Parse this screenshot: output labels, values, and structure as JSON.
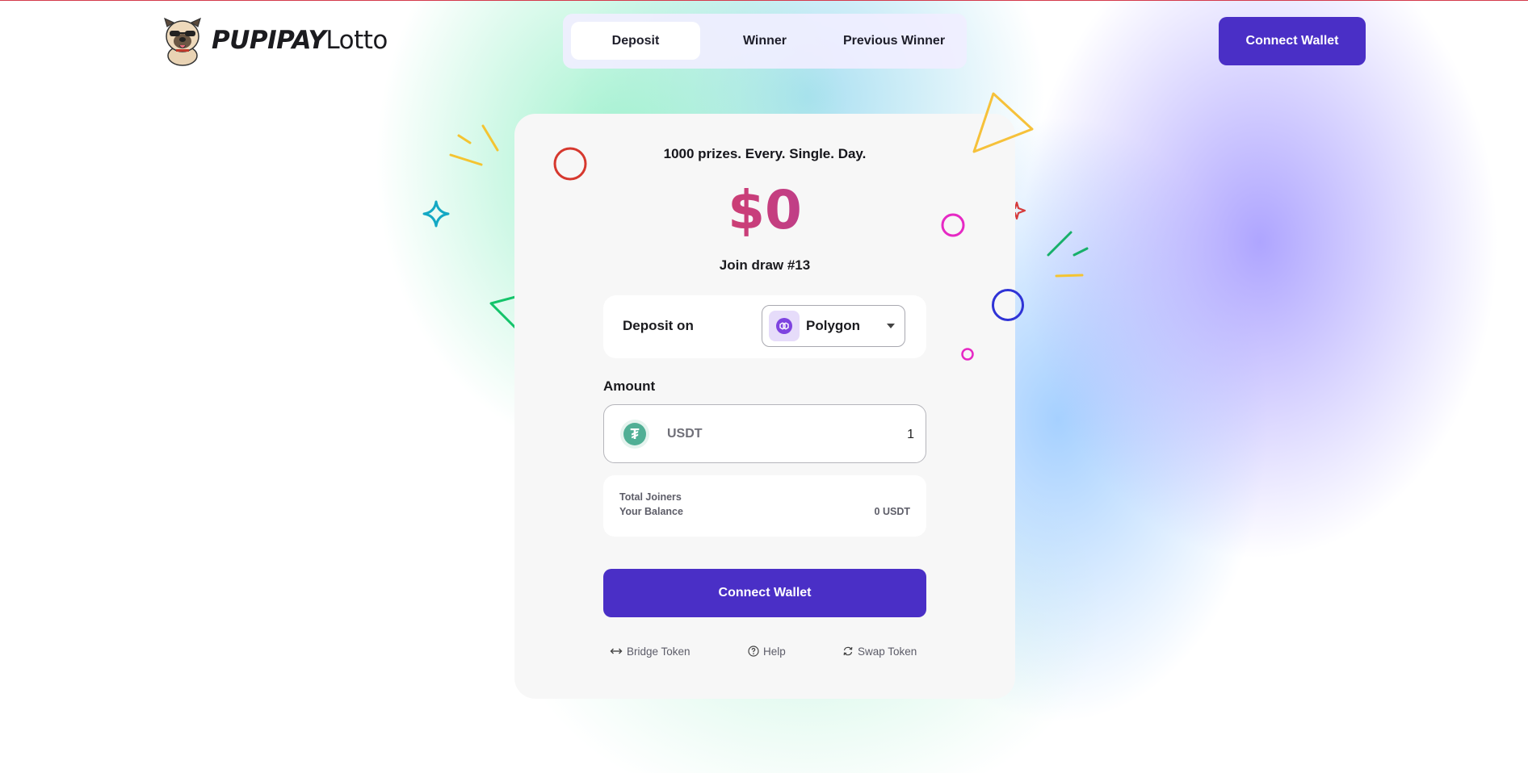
{
  "brand": {
    "bold": "PUPIPAY",
    "light": "Lotto"
  },
  "nav": {
    "tabs": [
      {
        "label": "Deposit",
        "active": true
      },
      {
        "label": "Winner",
        "active": false
      },
      {
        "label": "Previous Winner",
        "active": false
      }
    ],
    "connect_label": "Connect Wallet"
  },
  "card": {
    "tagline": "1000 prizes. Every. Single. Day.",
    "jackpot": "$0",
    "draw": "Join draw #13",
    "deposit_label": "Deposit on",
    "network": {
      "name": "Polygon",
      "icon": "polygon-icon"
    },
    "amount_label": "Amount",
    "amount": {
      "currency": "USDT",
      "value": "1",
      "icon": "tether-icon"
    },
    "stats": {
      "total_joiners_label": "Total Joiners",
      "total_joiners_value": "",
      "balance_label": "Your Balance",
      "balance_value": "0 USDT"
    },
    "connect_label": "Connect Wallet",
    "links": {
      "bridge": "Bridge Token",
      "help": "Help",
      "swap": "Swap Token"
    }
  },
  "colors": {
    "accent": "#4a2fc6",
    "jackpot_gradient": [
      "#ef3d3f",
      "#c23e84",
      "#7a3fc8"
    ],
    "tether": "#50af95"
  }
}
